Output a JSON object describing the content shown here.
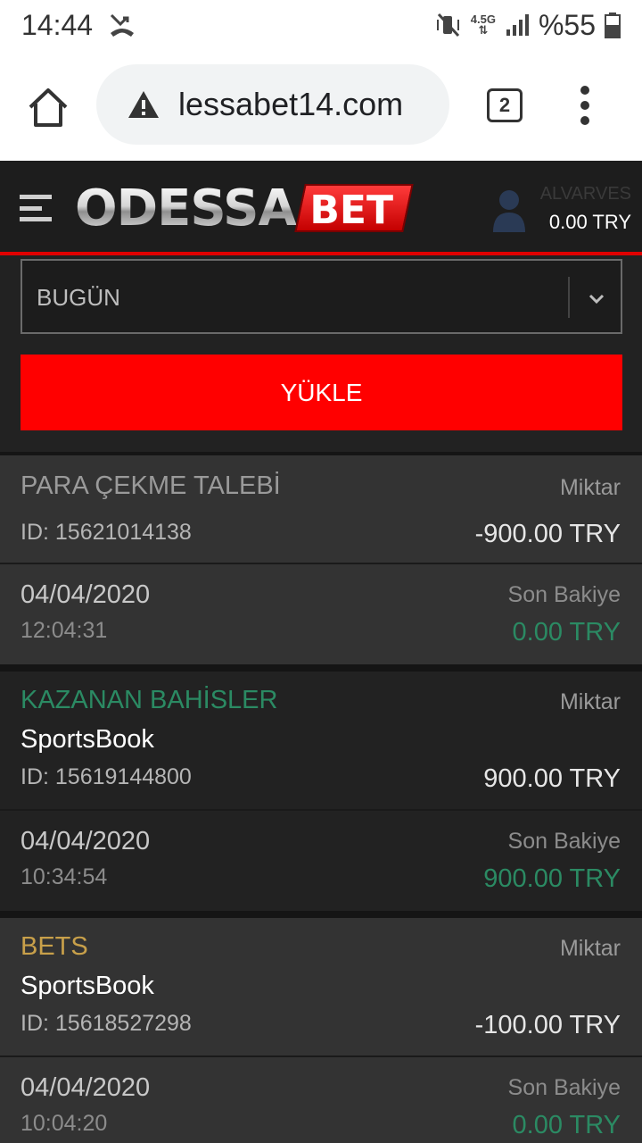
{
  "status": {
    "time": "14:44",
    "network": "4.5G",
    "battery": "%55"
  },
  "browser": {
    "url": "lessabet14.com",
    "tab_count": "2"
  },
  "header": {
    "logo_main": "ODESSA",
    "logo_sub": "BET",
    "username": "ALVARVES",
    "balance": "0.00 TRY"
  },
  "filter": {
    "period": "BUGÜN",
    "load_label": "YÜKLE"
  },
  "transactions": [
    {
      "type": "PARA ÇEKME TALEBİ",
      "sub": "",
      "id": "ID: 15621014138",
      "amount_label": "Miktar",
      "amount": "-900.00 TRY",
      "date": "04/04/2020",
      "time": "12:04:31",
      "balance_label": "Son Bakiye",
      "balance": "0.00 TRY"
    },
    {
      "type": "KAZANAN BAHİSLER",
      "sub": "SportsBook",
      "id": "ID: 15619144800",
      "amount_label": "Miktar",
      "amount": "900.00 TRY",
      "date": "04/04/2020",
      "time": "10:34:54",
      "balance_label": "Son Bakiye",
      "balance": "900.00 TRY"
    },
    {
      "type": "BETS",
      "sub": "SportsBook",
      "id": "ID: 15618527298",
      "amount_label": "Miktar",
      "amount": "-100.00 TRY",
      "date": "04/04/2020",
      "time": "10:04:20",
      "balance_label": "Son Bakiye",
      "balance": "0.00 TRY"
    }
  ],
  "colors": {
    "accent": "#ff0000",
    "withdraw": "#9a9a9a",
    "win": "#2b8a63",
    "bet": "#c8a04a",
    "balance": "#2b8a63"
  }
}
